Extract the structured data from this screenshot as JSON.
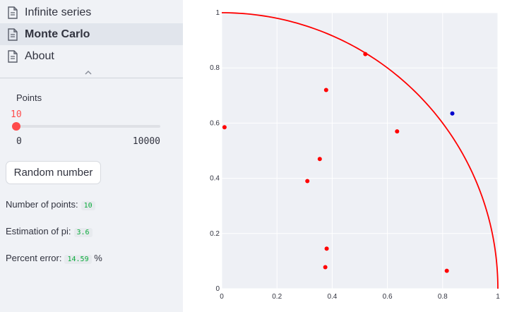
{
  "sidebar": {
    "nav_items": [
      {
        "label": "Infinite series",
        "icon": "document-icon",
        "active": false
      },
      {
        "label": "Monte Carlo",
        "icon": "document-icon",
        "active": true
      },
      {
        "label": "About",
        "icon": "document-icon",
        "active": false
      }
    ],
    "collapse_icon": "chevron-up-icon",
    "slider": {
      "label": "Points",
      "value": "10",
      "min": "0",
      "max": "10000",
      "fraction": 0.001
    },
    "button_label": "Random number",
    "stats": {
      "points_label": "Number of points:",
      "points_value": "10",
      "pi_label": "Estimation of pi:",
      "pi_value": "3.6",
      "error_label": "Percent error:",
      "error_value": "14.59",
      "error_unit": "%"
    }
  },
  "colors": {
    "accent": "#ff4b4b",
    "inside_point": "#ff0000",
    "outside_point": "#0000cc",
    "arc": "#ff0000",
    "plot_bg": "#eef0f5",
    "code_text": "#09ab3b"
  },
  "chart_data": {
    "type": "scatter",
    "title": "",
    "xlabel": "",
    "ylabel": "",
    "xlim": [
      0,
      1
    ],
    "ylim": [
      0,
      1
    ],
    "grid": true,
    "x_ticks": [
      "0",
      "0.2",
      "0.4",
      "0.6",
      "0.8",
      "1"
    ],
    "y_ticks": [
      "0",
      "0.2",
      "0.4",
      "0.6",
      "0.8",
      "1"
    ],
    "curve": "quarter circle x^2 + y^2 = 1",
    "series": [
      {
        "color": "#ff0000",
        "points": [
          [
            0.01,
            0.585
          ],
          [
            0.378,
            0.72
          ],
          [
            0.52,
            0.85
          ],
          [
            0.635,
            0.57
          ],
          [
            0.355,
            0.47
          ],
          [
            0.31,
            0.39
          ],
          [
            0.38,
            0.145
          ],
          [
            0.375,
            0.078
          ],
          [
            0.815,
            0.065
          ]
        ]
      },
      {
        "color": "#0000cc",
        "points": [
          [
            0.835,
            0.635
          ]
        ]
      }
    ]
  }
}
